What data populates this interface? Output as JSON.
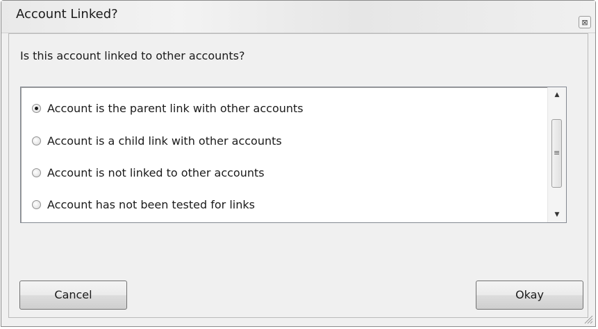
{
  "window": {
    "title": "Account Linked?",
    "close_glyph": "⊠"
  },
  "prompt": "Is this account linked to other accounts?",
  "options": [
    {
      "label": "Account is the parent link with other accounts",
      "selected": true
    },
    {
      "label": "Account is a child link with other accounts",
      "selected": false
    },
    {
      "label": "Account is not linked to other accounts",
      "selected": false
    },
    {
      "label": "Account has not been tested for links",
      "selected": false
    }
  ],
  "scrollbar": {
    "up_icon": "▲",
    "down_icon": "▼",
    "grip_icon": "≡"
  },
  "buttons": {
    "cancel_label": "Cancel",
    "okay_label": "Okay"
  }
}
